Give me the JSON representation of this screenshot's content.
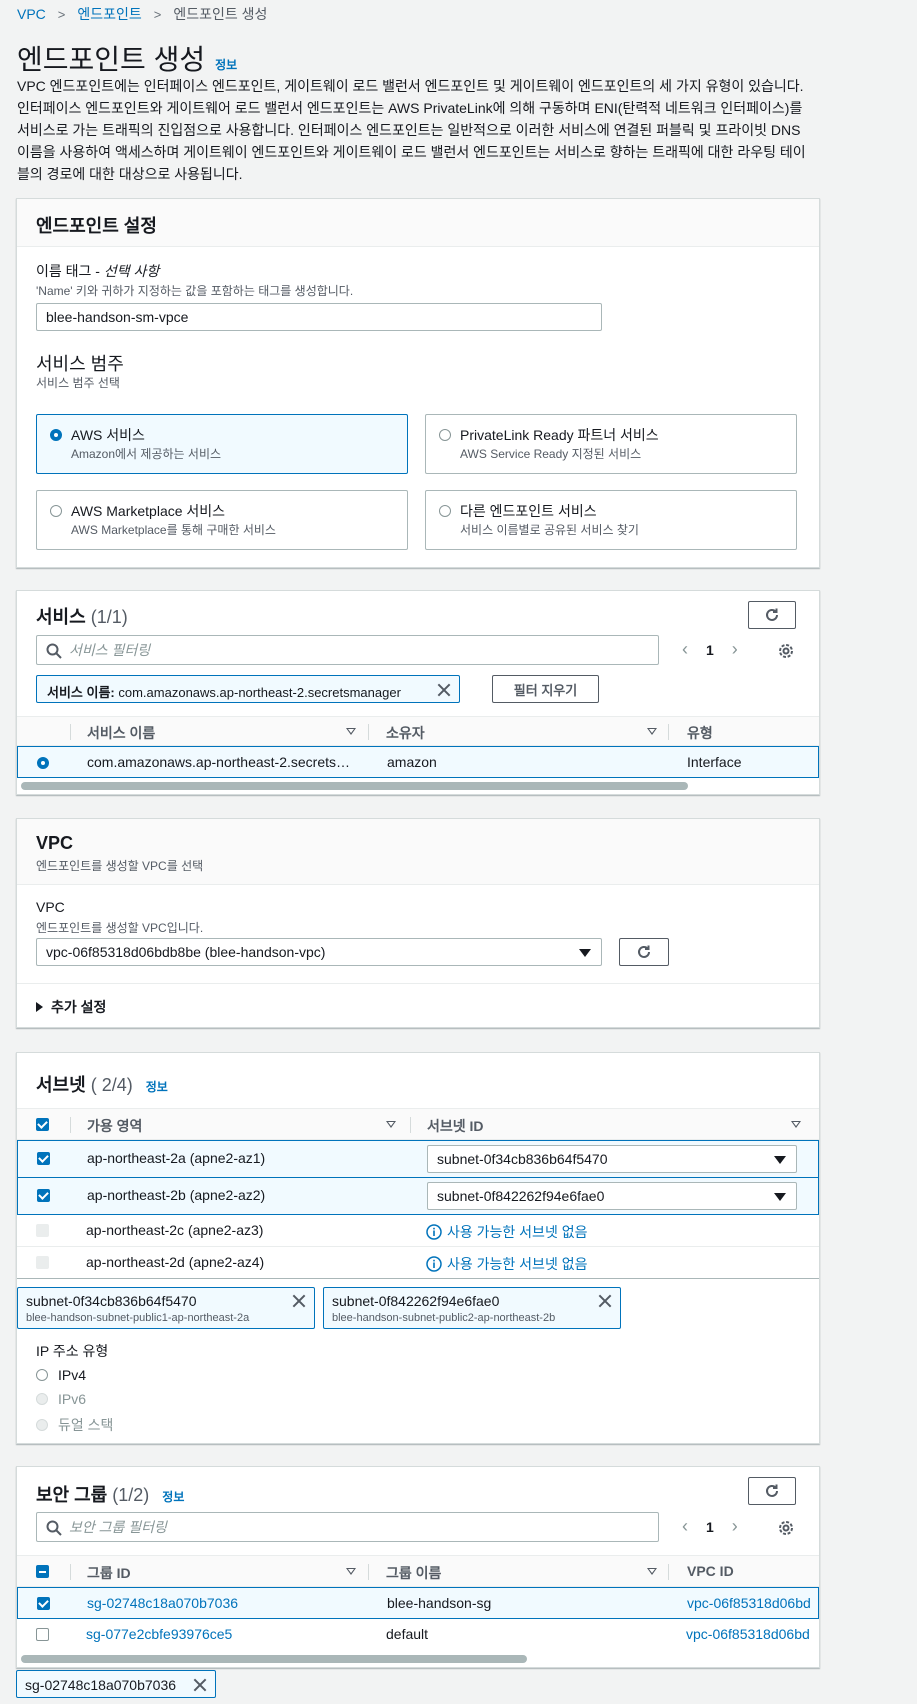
{
  "breadcrumb": {
    "root": "VPC",
    "parent": "엔드포인트",
    "current": "엔드포인트 생성"
  },
  "page": {
    "title": "엔드포인트 생성",
    "info": "정보",
    "description": "VPC 엔드포인트에는 인터페이스 엔드포인트, 게이트웨이 로드 밸런서 엔드포인트 및 게이트웨이 엔드포인트의 세 가지 유형이 있습니다. 인터페이스 엔드포인트와 게이트웨어 로드 밸런서 엔드포인트는 AWS PrivateLink에 의해 구동하며 ENI(탄력적 네트워크 인터페이스)를 서비스로 가는 트래픽의 진입점으로 사용합니다. 인터페이스 엔드포인트는 일반적으로 이러한 서비스에 연결된 퍼블릭 및 프라이빗 DNS 이름을 사용하여 액세스하며 게이트웨이 엔드포인트와 게이트웨이 로드 밸런서 엔드포인트는 서비스로 향하는 트래픽에 대한 라우팅 테이블의 경로에 대한 대상으로 사용됩니다."
  },
  "settings": {
    "title": "엔드포인트 설정",
    "name_tag_label": "이름 태그 - ",
    "name_tag_optional": "선택 사항",
    "name_tag_hint": "'Name' 키와 귀하가 지정하는 값을 포함하는 태그를 생성합니다.",
    "name_tag_value": "blee-handson-sm-vpce",
    "category_title": "서비스 범주",
    "category_hint": "서비스 범주 선택",
    "options": [
      {
        "title": "AWS 서비스",
        "sub": "Amazon에서 제공하는 서비스"
      },
      {
        "title": "PrivateLink Ready 파트너 서비스",
        "sub": "AWS Service Ready 지정된 서비스"
      },
      {
        "title": "AWS Marketplace 서비스",
        "sub": "AWS Marketplace를 통해 구매한 서비스"
      },
      {
        "title": "다른 엔드포인트 서비스",
        "sub": "서비스 이름별로 공유된 서비스 찾기"
      }
    ]
  },
  "services": {
    "title": "서비스",
    "count": "(1/1)",
    "filter_placeholder": "서비스 필터링",
    "page": "1",
    "token_key": "서비스 이름:",
    "token_value": "com.amazonaws.ap-northeast-2.secretsmanager",
    "clear_filter": "필터 지우기",
    "columns": [
      "서비스 이름",
      "소유자",
      "유형"
    ],
    "rows": [
      {
        "name": "com.amazonaws.ap-northeast-2.secrets…",
        "owner": "amazon",
        "type": "Interface"
      }
    ]
  },
  "vpc": {
    "title": "VPC",
    "hint": "엔드포인트를 생성할 VPC를 선택",
    "field_label": "VPC",
    "field_hint": "엔드포인트를 생성할 VPC입니다.",
    "value": "vpc-06f85318d06bdb8be (blee-handson-vpc)",
    "additional": "추가 설정"
  },
  "subnets": {
    "title": "서브넷",
    "count": "( 2/4)",
    "info": "정보",
    "columns": [
      "가용 영역",
      "서브넷 ID"
    ],
    "rows": [
      {
        "az": "ap-northeast-2a (apne2-az1)",
        "subnet": "subnet-0f34cb836b64f5470"
      },
      {
        "az": "ap-northeast-2b (apne2-az2)",
        "subnet": "subnet-0f842262f94e6fae0"
      },
      {
        "az": "ap-northeast-2c (apne2-az3)",
        "subnet": "사용 가능한 서브넷 없음"
      },
      {
        "az": "ap-northeast-2d (apne2-az4)",
        "subnet": "사용 가능한 서브넷 없음"
      }
    ],
    "tokens": [
      {
        "id": "subnet-0f34cb836b64f5470",
        "name": "blee-handson-subnet-public1-ap-northeast-2a"
      },
      {
        "id": "subnet-0f842262f94e6fae0",
        "name": "blee-handson-subnet-public2-ap-northeast-2b"
      }
    ],
    "ip_label": "IP 주소 유형",
    "ip_options": [
      "IPv4",
      "IPv6",
      "듀얼 스택"
    ]
  },
  "security_groups": {
    "title": "보안 그룹",
    "count": "(1/2)",
    "info": "정보",
    "filter_placeholder": "보안 그룹 필터링",
    "page": "1",
    "columns": [
      "그룹 ID",
      "그룹 이름",
      "VPC ID"
    ],
    "rows": [
      {
        "id": "sg-02748c18a070b7036",
        "name": "blee-handson-sg",
        "vpc": "vpc-06f85318d06bd"
      },
      {
        "id": "sg-077e2cbfe93976ce5",
        "name": "default",
        "vpc": "vpc-06f85318d06bd"
      }
    ],
    "token": "sg-02748c18a070b7036"
  },
  "colors": {
    "accent": "#0073bb",
    "selected_bg": "#f1faff",
    "border": "#aab7b8"
  }
}
